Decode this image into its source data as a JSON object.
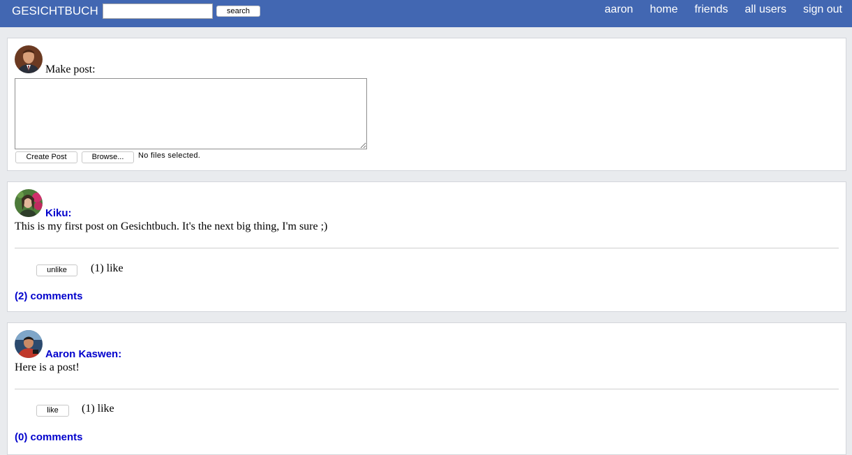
{
  "header": {
    "brand": "GESICHTBUCH",
    "search_placeholder": "",
    "search_value": "",
    "search_button": "search",
    "nav": [
      "aaron",
      "home",
      "friends",
      "all users",
      "sign out"
    ]
  },
  "composer": {
    "label": "Make post:",
    "create_button": "Create Post",
    "browse_button": "Browse...",
    "file_status": "No files selected."
  },
  "posts": [
    {
      "author": "Kiku:",
      "text": "This is my first post on Gesichtbuch. It's the next big thing, I'm sure ;)",
      "like_button": "unlike",
      "like_count": "(1) like",
      "comments": "(2) comments"
    },
    {
      "author": "Aaron Kaswen:",
      "text": "Here is a post!",
      "like_button": "like",
      "like_count": "(1) like",
      "comments": "(0) comments"
    }
  ],
  "colors": {
    "header_bg": "#4267b2",
    "page_bg": "#e9ebee",
    "link": "#0000cc"
  }
}
